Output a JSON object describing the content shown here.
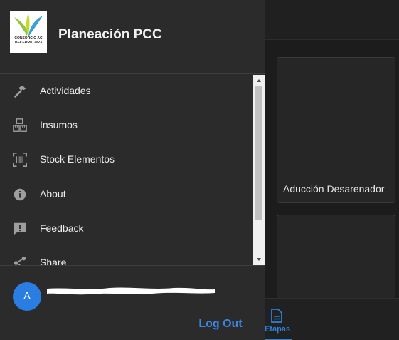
{
  "app": {
    "title": "Planeación PCC",
    "logo_text": "CONSORCIO AC\nBECERRIL 2023"
  },
  "menu": {
    "items": [
      {
        "label": "Actividades",
        "icon": "hammer-icon"
      },
      {
        "label": "Insumos",
        "icon": "boxes-icon"
      },
      {
        "label": "Stock Elementos",
        "icon": "barcode-scan-icon"
      },
      {
        "label": "About",
        "icon": "info-icon"
      },
      {
        "label": "Feedback",
        "icon": "feedback-icon"
      },
      {
        "label": "Share",
        "icon": "share-icon"
      }
    ]
  },
  "user": {
    "avatar_initial": "A",
    "name": "",
    "logout_label": "Log Out"
  },
  "background": {
    "cards": [
      {
        "title": "Aducción Desarenador"
      },
      {
        "title": ""
      }
    ],
    "bottom_nav": {
      "active_label": "Etapas",
      "active_icon": "document-icon"
    }
  },
  "colors": {
    "accent": "#2f80d8",
    "avatar": "#2a7de1",
    "drawer_bg": "#2b2b2b"
  }
}
